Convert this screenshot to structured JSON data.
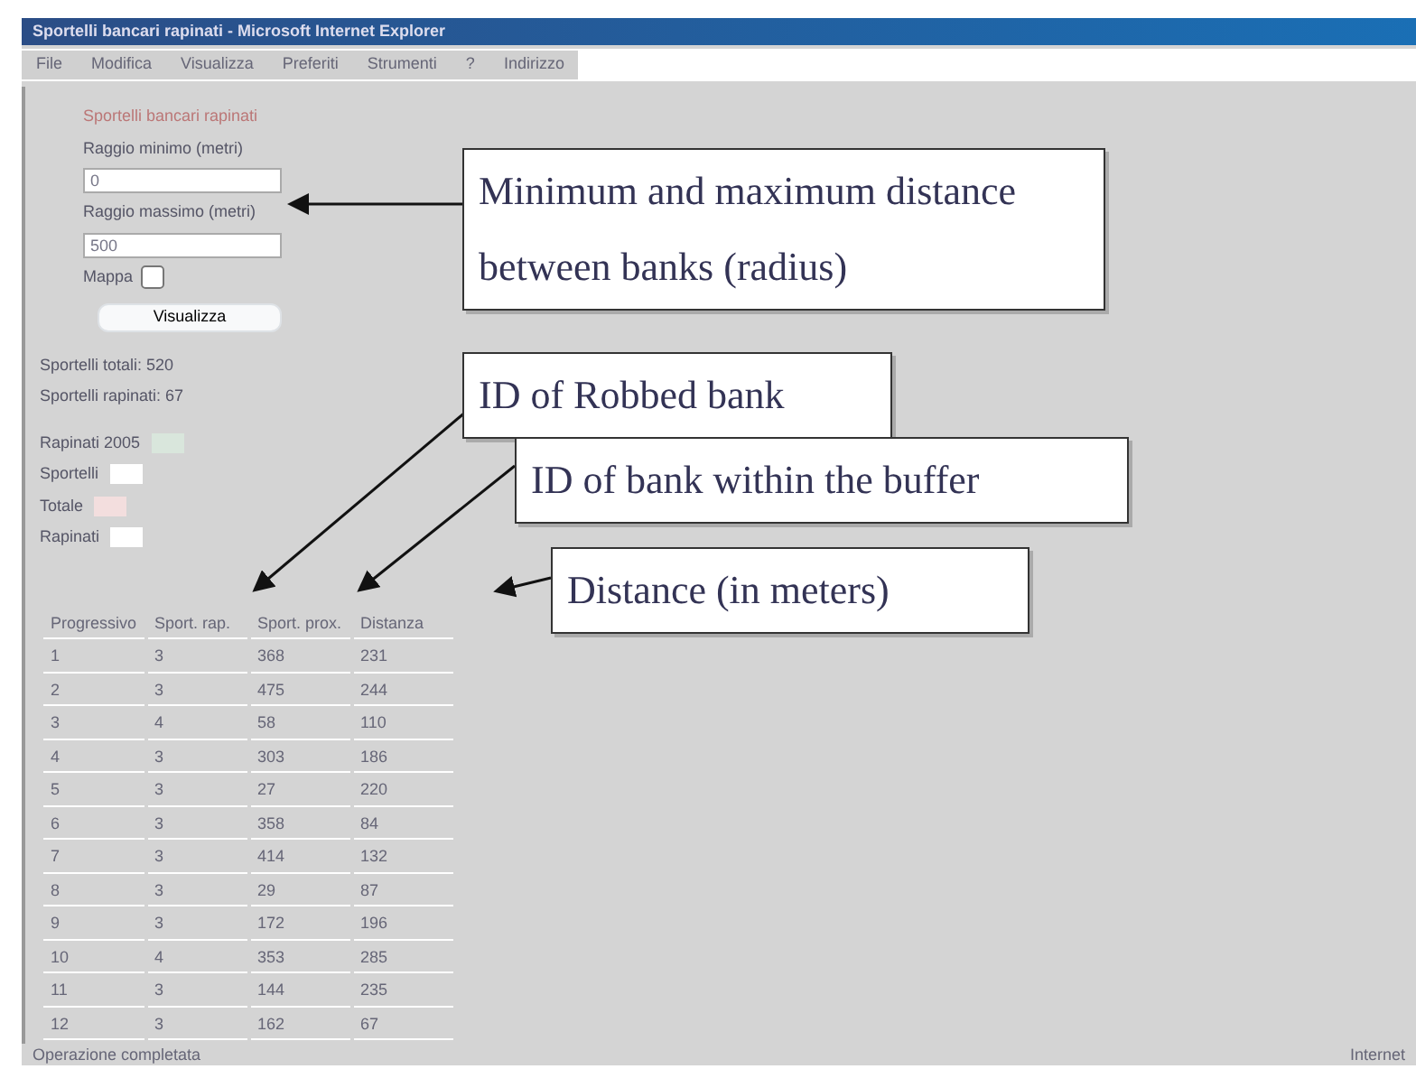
{
  "window": {
    "title": "Sportelli bancari rapinati - Microsoft Internet Explorer"
  },
  "menu": [
    "File",
    "Modifica",
    "Visualizza",
    "Preferiti",
    "Strumenti",
    "?",
    "Indirizzo"
  ],
  "form": {
    "heading": "Sportelli bancari rapinati",
    "fields": [
      {
        "label": "Raggio minimo (metri)",
        "value": "0"
      },
      {
        "label": "Raggio massimo (metri)",
        "value": "500"
      }
    ],
    "checkbox": {
      "label": "Mappa",
      "checked": false
    },
    "button": "Visualizza"
  },
  "counts": [
    "Sportelli totali: 520",
    "Sportelli rapinati: 67"
  ],
  "legend": [
    {
      "label": "Rapinati 2005",
      "color": "#d9e6dc"
    },
    {
      "label": "Sportelli",
      "color": "#ffffff"
    },
    {
      "label": "Totale",
      "color": "#f3dede"
    },
    {
      "label": "Rapinati",
      "color": "#ffffff"
    }
  ],
  "table": {
    "columns": [
      "Progressivo",
      "Sport. rap.",
      "Sport. prox.",
      "Distanza"
    ],
    "rows": [
      [
        "1",
        "3",
        "368",
        "231"
      ],
      [
        "2",
        "3",
        "475",
        "244"
      ],
      [
        "3",
        "4",
        "58",
        "110"
      ],
      [
        "4",
        "3",
        "303",
        "186"
      ],
      [
        "5",
        "3",
        "27",
        "220"
      ],
      [
        "6",
        "3",
        "358",
        "84"
      ],
      [
        "7",
        "3",
        "414",
        "132"
      ],
      [
        "8",
        "3",
        "29",
        "87"
      ],
      [
        "9",
        "3",
        "172",
        "196"
      ],
      [
        "10",
        "4",
        "353",
        "285"
      ],
      [
        "11",
        "3",
        "144",
        "235"
      ],
      [
        "12",
        "3",
        "162",
        "67"
      ]
    ]
  },
  "callouts": [
    {
      "text": "Minimum and maximum distance between banks (radius)"
    },
    {
      "text": "ID of Robbed bank"
    },
    {
      "text": "ID of bank within the buffer"
    },
    {
      "text": "Distance (in meters)"
    }
  ],
  "status_bar": {
    "text": "Operazione completata",
    "zone": "Internet"
  }
}
